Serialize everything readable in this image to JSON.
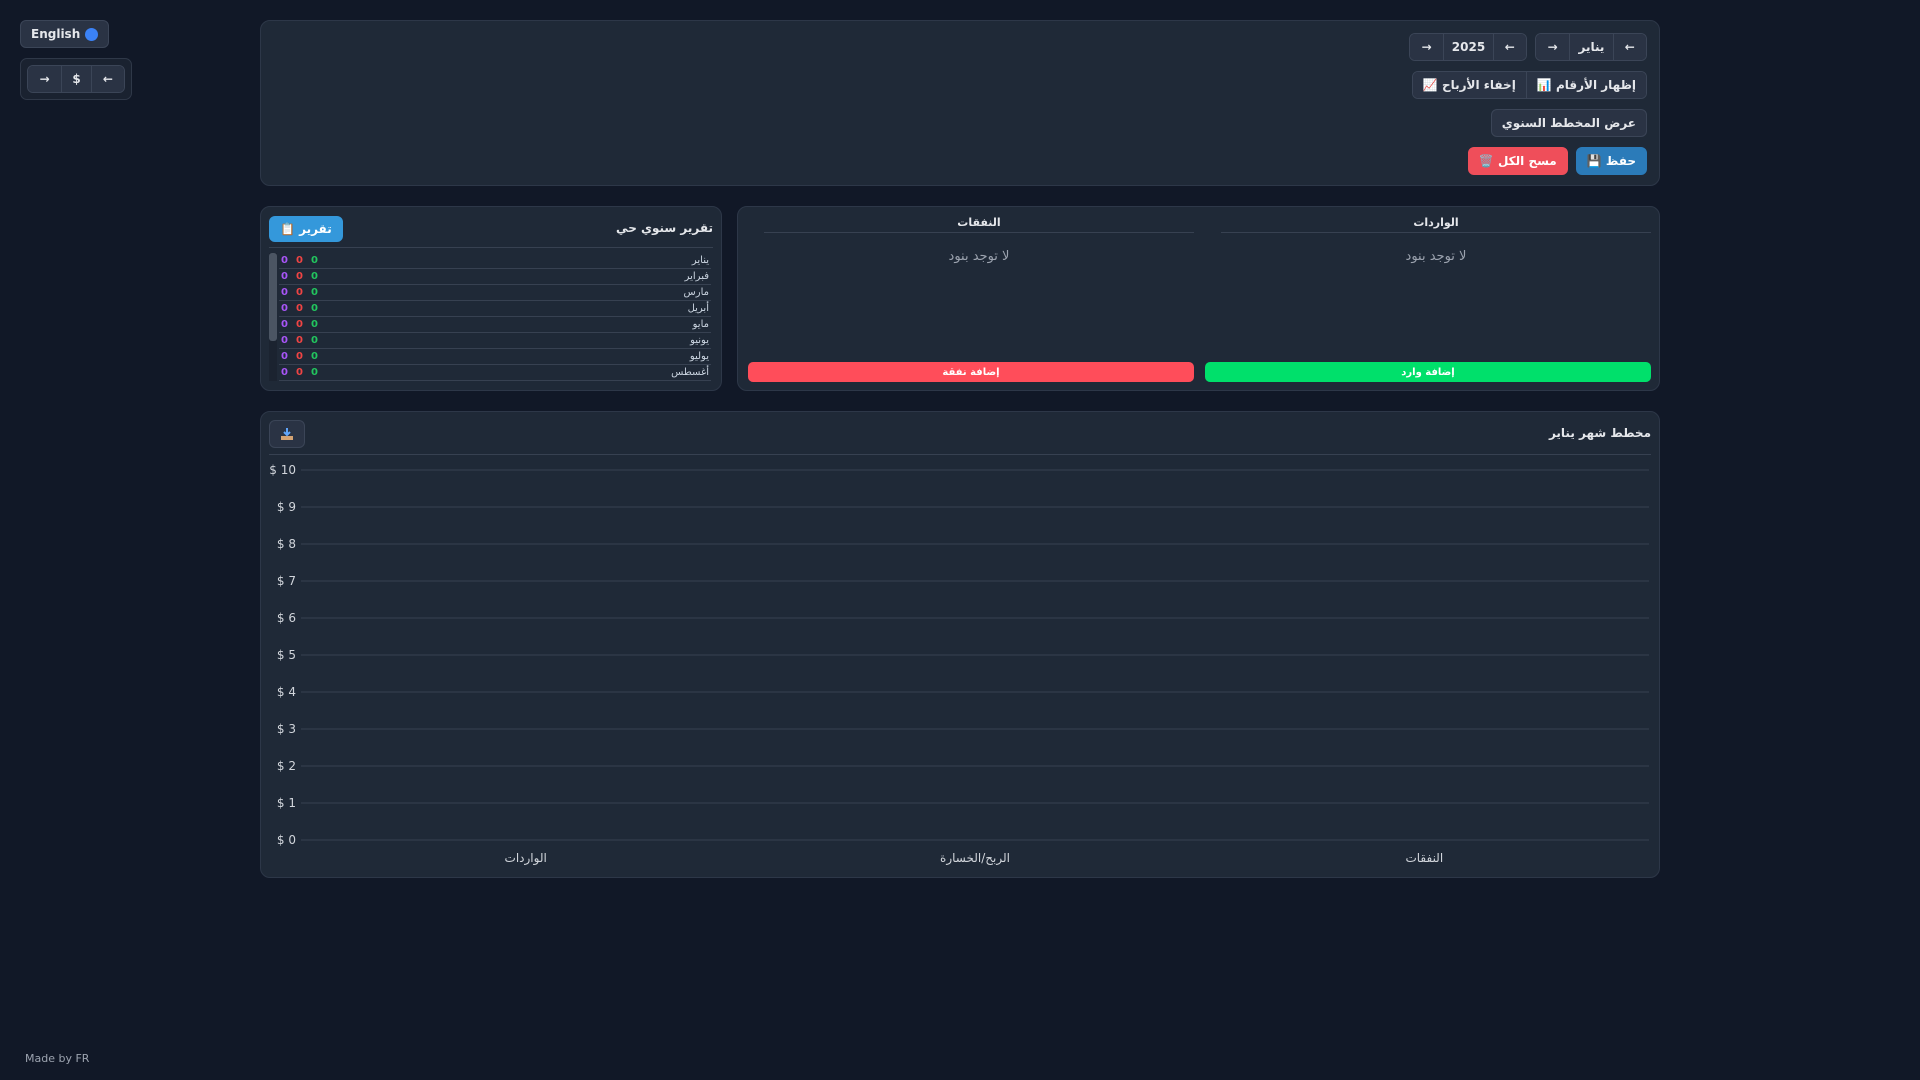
{
  "language_button": {
    "label": "English",
    "icon": "globe-icon"
  },
  "currency": {
    "prev": "←",
    "symbol": "$",
    "next": "→"
  },
  "month_selector": {
    "prev": "←",
    "value": "يناير",
    "next": "→"
  },
  "year_selector": {
    "prev": "←",
    "value": "2025",
    "next": "→"
  },
  "toggles": {
    "show_numbers": "📊 إظهار الأرقام",
    "hide_profits": "📈 إخفاء الأرباح"
  },
  "annual_chart_button": "عرض المخطط السنوي",
  "actions": {
    "save": "💾 حفظ",
    "clear_all": "🗑️ مسح الكل"
  },
  "income": {
    "header": "الواردات",
    "empty": "لا توجد بنود",
    "add": "إضافة وارد",
    "color": "#00e06b"
  },
  "expenses": {
    "header": "النفقات",
    "empty": "لا توجد بنود",
    "add": "إضافة نفقة",
    "color": "#ff4d5a"
  },
  "report": {
    "title": "تقرير سنوي حي",
    "button": "📋 تقرير",
    "rows": [
      {
        "month": "يناير",
        "income": "0",
        "expense": "0",
        "profit": "0"
      },
      {
        "month": "فبراير",
        "income": "0",
        "expense": "0",
        "profit": "0"
      },
      {
        "month": "مارس",
        "income": "0",
        "expense": "0",
        "profit": "0"
      },
      {
        "month": "أبريل",
        "income": "0",
        "expense": "0",
        "profit": "0"
      },
      {
        "month": "مايو",
        "income": "0",
        "expense": "0",
        "profit": "0"
      },
      {
        "month": "يونيو",
        "income": "0",
        "expense": "0",
        "profit": "0"
      },
      {
        "month": "يوليو",
        "income": "0",
        "expense": "0",
        "profit": "0"
      },
      {
        "month": "أغسطس",
        "income": "0",
        "expense": "0",
        "profit": "0"
      }
    ]
  },
  "chart_panel": {
    "title": "مخطط شهر يناير",
    "download_icon": "download-icon"
  },
  "chart_data": {
    "type": "bar",
    "title": "مخطط شهر يناير",
    "categories": [
      "الواردات",
      "الربح/الخسارة",
      "النفقات"
    ],
    "values": [
      0,
      0,
      0
    ],
    "ylim": [
      0,
      10
    ],
    "yticks": [
      "$ 0",
      "$ 1",
      "$ 2",
      "$ 3",
      "$ 4",
      "$ 5",
      "$ 6",
      "$ 7",
      "$ 8",
      "$ 9",
      "$ 10"
    ],
    "grid": true
  },
  "footer": "Made by FR"
}
